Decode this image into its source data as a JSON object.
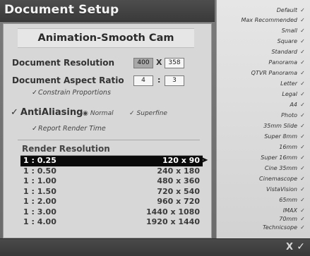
{
  "window": {
    "title": "Document Setup"
  },
  "camera": {
    "name": "Animation-Smooth Cam"
  },
  "document_resolution": {
    "label": "Document Resolution",
    "width": "400",
    "separator": "X",
    "height": "358"
  },
  "aspect_ratio": {
    "label": "Document Aspect Ratio",
    "a": "4",
    "separator": ":",
    "b": "3",
    "constrain_label": "Constrain Proportions",
    "constrain_mark": "✓"
  },
  "antialiasing": {
    "label": "AntiAliasing",
    "mark": "✓",
    "options": [
      {
        "label": "Normal",
        "selected": true,
        "dot": "◉"
      },
      {
        "label": "Superfine",
        "selected": false,
        "dot": "✓"
      }
    ],
    "report_label": "Report Render Time",
    "report_mark": "✓"
  },
  "render_resolution": {
    "title": "Render Resolution",
    "rows": [
      {
        "ratio": "1 : 0.25",
        "dims": "120 x 90",
        "selected": true
      },
      {
        "ratio": "1 : 0.50",
        "dims": "240 x 180",
        "selected": false
      },
      {
        "ratio": "1 : 1.00",
        "dims": "480 x 360",
        "selected": false
      },
      {
        "ratio": "1 : 1.50",
        "dims": "720 x 540",
        "selected": false
      },
      {
        "ratio": "1 : 2.00",
        "dims": "960 x 720",
        "selected": false
      },
      {
        "ratio": "1 : 3.00",
        "dims": "1440 x 1080",
        "selected": false
      },
      {
        "ratio": "1 : 4.00",
        "dims": "1920 x 1440",
        "selected": false
      }
    ]
  },
  "presets": {
    "mark": "✓",
    "items": [
      "Default",
      "Max Recommended",
      "Small",
      "Square",
      "Standard",
      "Panorama",
      "QTVR Panorama",
      "Letter",
      "Legal",
      "A4",
      "Photo",
      "35mm Slide",
      "Super 8mm",
      "16mm",
      "Super 16mm",
      "Cine 35mm",
      "Cinemascope",
      "VistaVision",
      "65mm",
      "IMAX",
      "70mm",
      "Technicsope"
    ]
  },
  "footer": {
    "cancel": "X",
    "ok": "✓"
  }
}
